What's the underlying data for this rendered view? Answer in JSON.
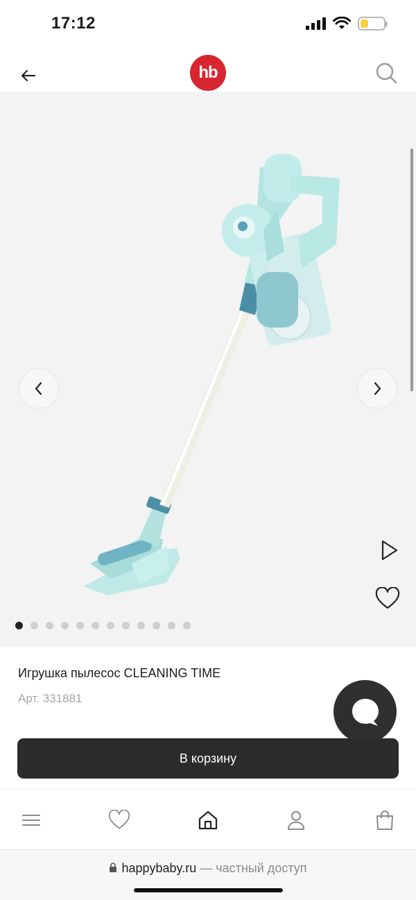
{
  "status_bar": {
    "time": "17:12",
    "battery_level": 0.35,
    "battery_color": "#f5d142"
  },
  "header": {
    "logo_text": "hb",
    "logo_color": "#d7262f",
    "back_icon": "arrow-left-icon",
    "search_icon": "search-icon"
  },
  "gallery": {
    "image_alt": "vacuum-cleaner-toy",
    "total_slides": 12,
    "active_slide": 1,
    "prev_icon": "chevron-left-icon",
    "next_icon": "chevron-right-icon",
    "video_icon": "play-icon",
    "favorite_icon": "heart-icon"
  },
  "product": {
    "title": "Игрушка пылесос CLEANING TIME",
    "sku": "Арт. 331881"
  },
  "actions": {
    "add_to_cart": "В корзину"
  },
  "bottom_nav": {
    "items": [
      {
        "icon": "menu-icon"
      },
      {
        "icon": "heart-icon"
      },
      {
        "icon": "home-icon"
      },
      {
        "icon": "user-icon"
      },
      {
        "icon": "bag-icon"
      }
    ]
  },
  "browser": {
    "domain": "happybaby.ru",
    "suffix": " — частный доступ"
  }
}
